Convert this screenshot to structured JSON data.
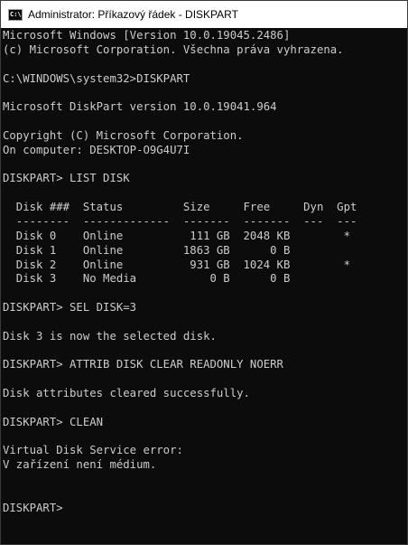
{
  "window": {
    "title": "Administrator: Příkazový řádek - DISKPART",
    "icon": "command-prompt-icon"
  },
  "colors": {
    "background": "#0c0c0c",
    "text": "#cccccc",
    "titlebar": "#ffffff"
  },
  "console": {
    "lines": [
      "Microsoft Windows [Version 10.0.19045.2486]",
      "(c) Microsoft Corporation. Všechna práva vyhrazena.",
      "",
      "C:\\WINDOWS\\system32>DISKPART",
      "",
      "Microsoft DiskPart version 10.0.19041.964",
      "",
      "Copyright (C) Microsoft Corporation.",
      "On computer: DESKTOP-O9G4U7I",
      "",
      "DISKPART> LIST DISK",
      "",
      "  Disk ###  Status         Size     Free     Dyn  Gpt",
      "  --------  -------------  -------  -------  ---  ---",
      "  Disk 0    Online          111 GB  2048 KB        *",
      "  Disk 1    Online         1863 GB      0 B",
      "  Disk 2    Online          931 GB  1024 KB        *",
      "  Disk 3    No Media           0 B      0 B",
      "",
      "DISKPART> SEL DISK=3",
      "",
      "Disk 3 is now the selected disk.",
      "",
      "DISKPART> ATTRIB DISK CLEAR READONLY NOERR",
      "",
      "Disk attributes cleared successfully.",
      "",
      "DISKPART> CLEAN",
      "",
      "Virtual Disk Service error:",
      "V zařízení není médium.",
      "",
      "",
      "DISKPART>"
    ]
  }
}
